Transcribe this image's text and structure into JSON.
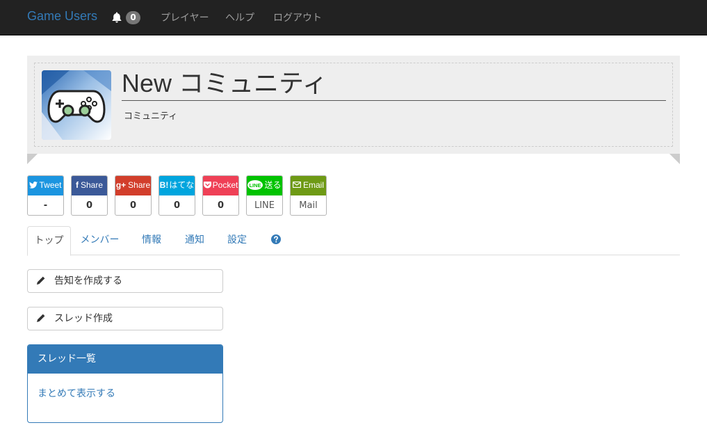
{
  "navbar": {
    "brand": "Game Users",
    "notification_count": "0",
    "links": [
      "プレイヤー",
      "ヘルプ",
      "ログアウト"
    ]
  },
  "community": {
    "title": "New コミュニティ",
    "subtitle": "コミュニティ",
    "avatar_icon": "gamepad-icon"
  },
  "share_buttons": [
    {
      "label": "Tweet",
      "icon": "twitter-icon",
      "count": "-",
      "color": "#1b95e0"
    },
    {
      "label": "Share",
      "icon": "facebook-icon",
      "count": "0",
      "color": "#3b5998"
    },
    {
      "label": "Share",
      "icon": "googleplus-icon",
      "count": "0",
      "color": "#d23e2b"
    },
    {
      "label": "はてな",
      "icon": "hatena-icon",
      "count": "0",
      "color": "#00a5de"
    },
    {
      "label": "Pocket",
      "icon": "pocket-icon",
      "count": "0",
      "color": "#ef4056"
    },
    {
      "label": "送る",
      "icon": "line-icon",
      "count": "LINE",
      "color": "#00c300"
    },
    {
      "label": "Email",
      "icon": "mail-icon",
      "count": "Mail",
      "color": "#6e9a15"
    }
  ],
  "tabs": [
    "トップ",
    "メンバー",
    "情報",
    "通知",
    "設定"
  ],
  "help_icon": "question-circle-icon",
  "actions": {
    "create_notice": "告知を作成する",
    "create_thread": "スレッド作成"
  },
  "thread_panel": {
    "title": "スレッド一覧",
    "link": "まとめて表示する"
  },
  "colors": {
    "navbar_bg": "#222222",
    "brand": "#337ab7",
    "panel_primary": "#337ab7"
  }
}
